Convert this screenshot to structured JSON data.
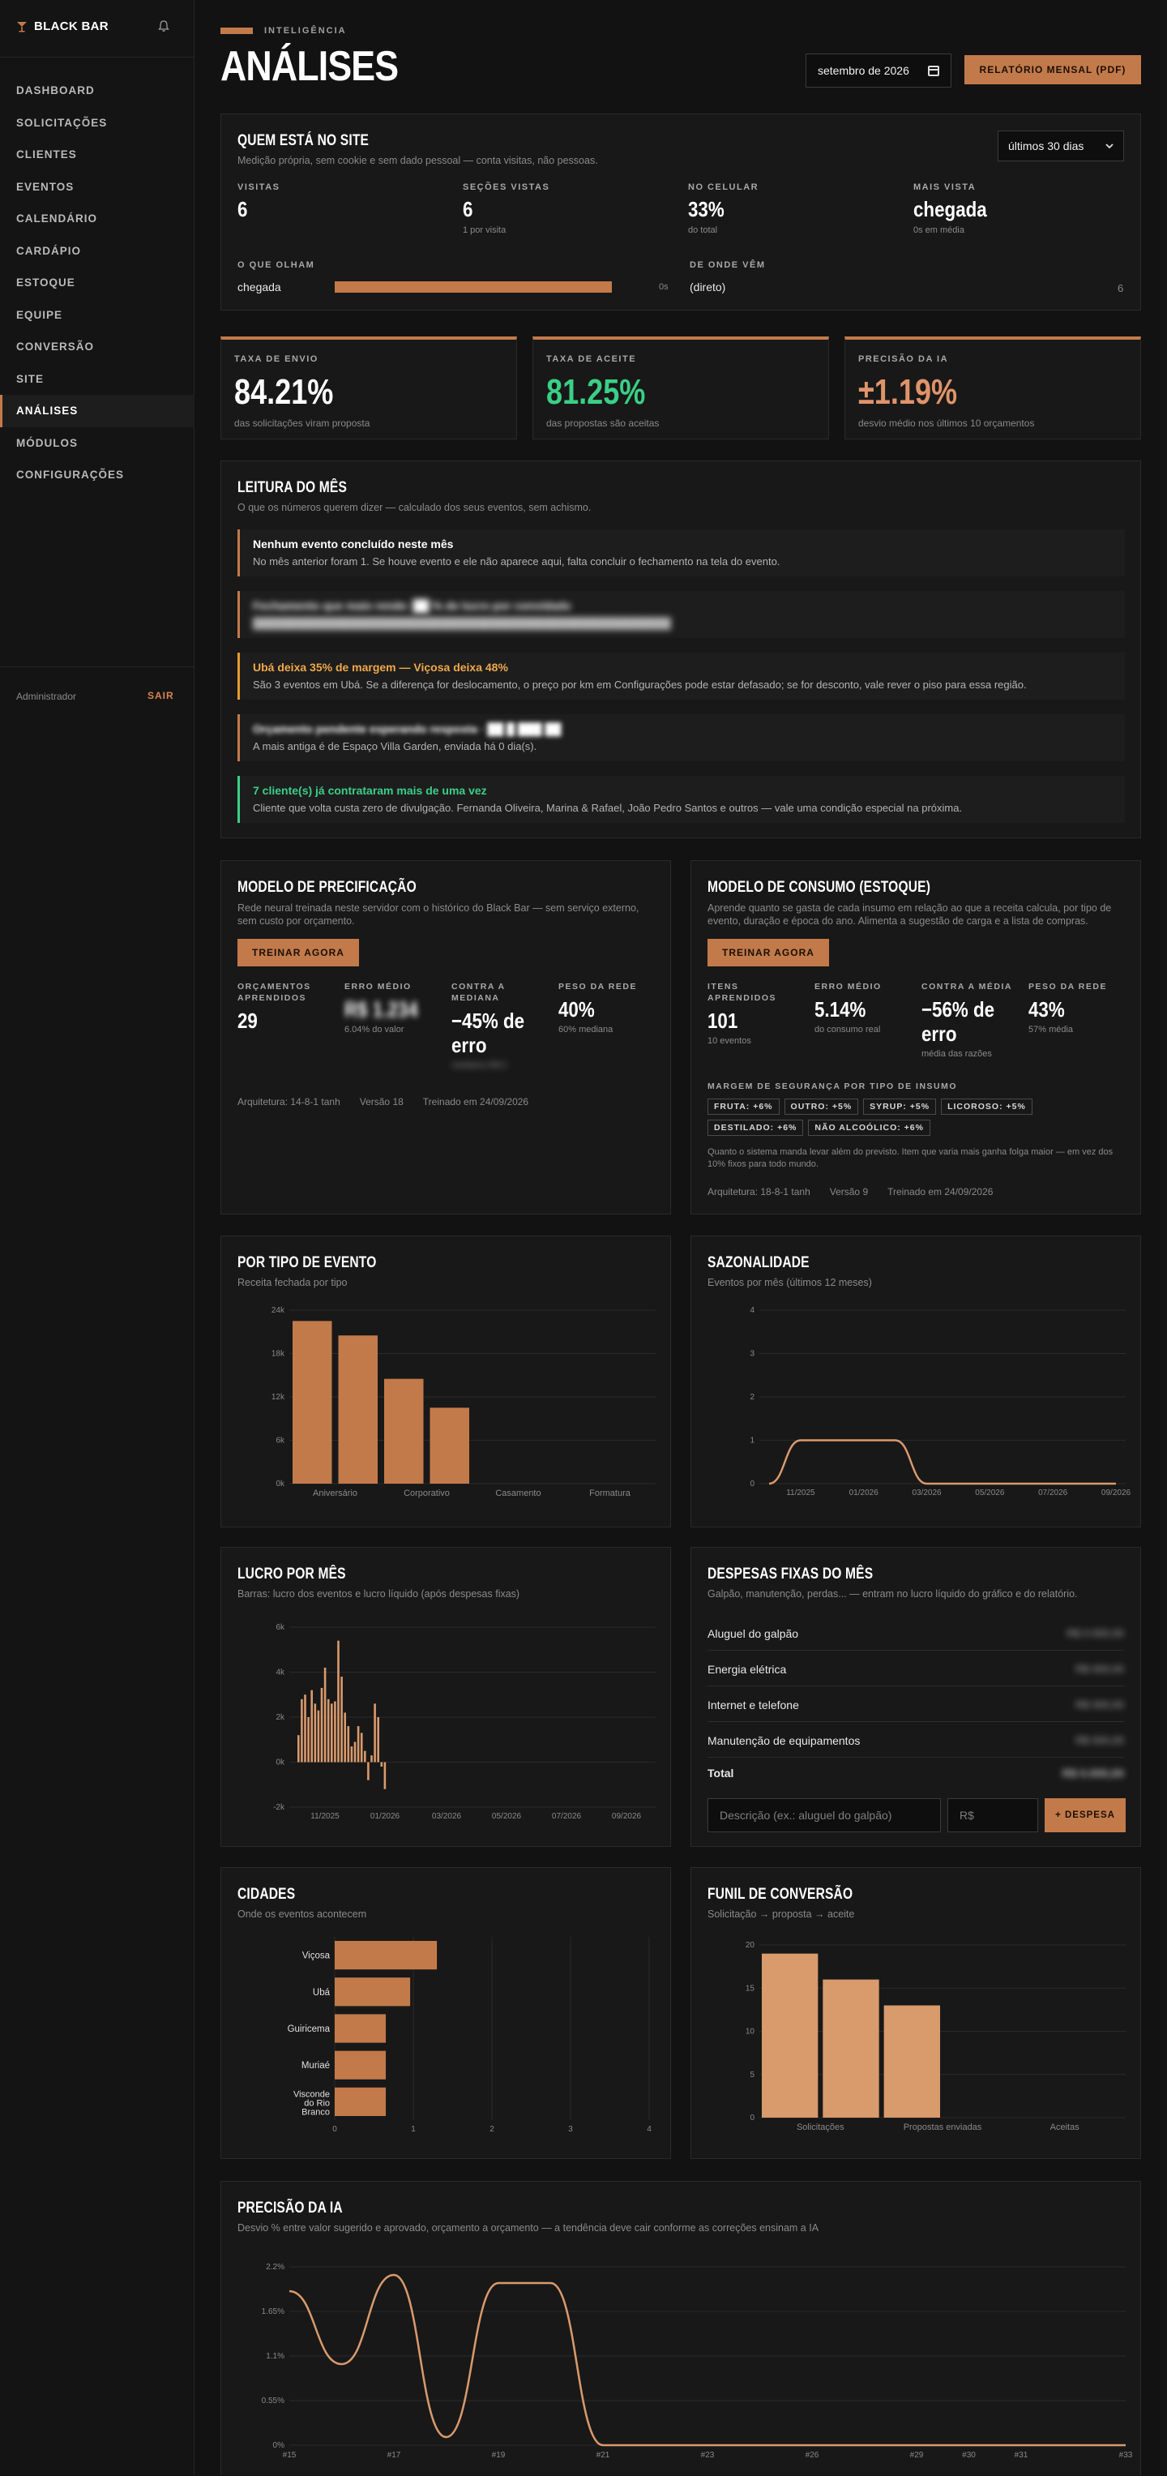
{
  "brand": {
    "name": "BLACK BAR"
  },
  "nav": {
    "items": [
      {
        "label": "DASHBOARD"
      },
      {
        "label": "SOLICITAÇÕES"
      },
      {
        "label": "CLIENTES"
      },
      {
        "label": "EVENTOS"
      },
      {
        "label": "CALENDÁRIO"
      },
      {
        "label": "CARDÁPIO"
      },
      {
        "label": "ESTOQUE"
      },
      {
        "label": "EQUIPE"
      },
      {
        "label": "CONVERSÃO"
      },
      {
        "label": "SITE"
      },
      {
        "label": "ANÁLISES",
        "active": true
      },
      {
        "label": "MÓDULOS"
      },
      {
        "label": "CONFIGURAÇÕES"
      }
    ],
    "user": "Administrador",
    "logout": "SAIR"
  },
  "header": {
    "eyebrow": "INTELIGÊNCIA",
    "title": "ANÁLISES",
    "month": "setembro de 2026",
    "report_button": "RELATÓRIO MENSAL (PDF)"
  },
  "visitors": {
    "title": "QUEM ESTÁ NO SITE",
    "subtitle": "Medição própria, sem cookie e sem dado pessoal — conta visitas, não pessoas.",
    "range": "últimos 30 dias",
    "stats": [
      {
        "label": "VISITAS",
        "value": "6",
        "note": ""
      },
      {
        "label": "SEÇÕES VISTAS",
        "value": "6",
        "note": "1 por visita"
      },
      {
        "label": "NO CELULAR",
        "value": "33%",
        "note": "do total"
      },
      {
        "label": "MAIS VISTA",
        "value": "chegada",
        "note": "0s em média"
      }
    ],
    "looked_label": "O QUE OLHAM",
    "looked_item": "chegada",
    "looked_value": "0s",
    "looked_fraction": 1.0,
    "from_label": "DE ONDE VÊM",
    "from_item": "(direto)",
    "from_value": "6"
  },
  "kpis": [
    {
      "label": "TAXA DE ENVIO",
      "value": "84.21%",
      "note": "das solicitações viram proposta",
      "color": "#ffffff"
    },
    {
      "label": "TAXA DE ACEITE",
      "value": "81.25%",
      "note": "das propostas são aceitas",
      "color": "#3bcf86"
    },
    {
      "label": "PRECISÃO DA IA",
      "value": "±1.19%",
      "note": "desvio médio nos últimos 10 orçamentos",
      "color": "#e0936a"
    }
  ],
  "reading": {
    "title": "LEITURA DO MÊS",
    "subtitle": "O que os números querem dizer — calculado dos seus eventos, sem achismo.",
    "items": [
      {
        "title": "Nenhum evento concluído neste mês",
        "body": "No mês anterior foram 1. Se houve evento e ele não aparece aqui, falta concluir o fechamento na tela do evento."
      },
      {
        "title": "Fechamento que mais rende: ██ % de lucro por convidado",
        "body": "████████████████████████████████████████████████████████"
      },
      {
        "title": "Ubá deixa 35% de margem — Viçosa deixa 48%",
        "body": "São 3 eventos em Ubá. Se a diferença for deslocamento, o preço por km em Configurações pode estar defasado; se for desconto, vale rever o piso para essa região."
      },
      {
        "title": "Orçamento pendente esperando resposta · ██ █ ███ ██",
        "body": "A mais antiga é de Espaço Villa Garden, enviada há 0 dia(s)."
      },
      {
        "title": "7 cliente(s) já contrataram mais de uma vez",
        "body": "Cliente que volta custa zero de divulgação. Fernanda Oliveira, Marina & Rafael, João Pedro Santos e outros — vale uma condição especial na próxima."
      }
    ]
  },
  "pricing_model": {
    "title": "MODELO DE PRECIFICAÇÃO",
    "subtitle": "Rede neural treinada neste servidor com o histórico do Black Bar — sem serviço externo, sem custo por orçamento.",
    "button": "TREINAR AGORA",
    "stats": [
      {
        "label": "ORÇAMENTOS APRENDIDOS",
        "value": "29",
        "note": ""
      },
      {
        "label": "ERRO MÉDIO",
        "value": "R$ 1.234",
        "note": "6.04% do valor"
      },
      {
        "label": "CONTRA A MEDIANA",
        "value": "−45% de erro",
        "note": "mediana R$ 0"
      },
      {
        "label": "PESO DA REDE",
        "value": "40%",
        "note": "60% mediana"
      }
    ],
    "footer": [
      "Arquitetura: 14-8-1 tanh",
      "Versão 18",
      "Treinado em 24/09/2026"
    ]
  },
  "consumption_model": {
    "title": "MODELO DE CONSUMO (ESTOQUE)",
    "subtitle": "Aprende quanto se gasta de cada insumo em relação ao que a receita calcula, por tipo de evento, duração e época do ano. Alimenta a sugestão de carga e a lista de compras.",
    "button": "TREINAR AGORA",
    "stats": [
      {
        "label": "ITENS APRENDIDOS",
        "value": "101",
        "note": "10 eventos"
      },
      {
        "label": "ERRO MÉDIO",
        "value": "5.14%",
        "note": "do consumo real"
      },
      {
        "label": "CONTRA A MÉDIA",
        "value": "−56% de erro",
        "note": "média das razões"
      },
      {
        "label": "PESO DA REDE",
        "value": "43%",
        "note": "57% média"
      }
    ],
    "margin_label": "MARGEM DE SEGURANÇA POR TIPO DE INSUMO",
    "chips": [
      "FRUTA: +6%",
      "OUTRO: +5%",
      "SYRUP: +5%",
      "LICOROSO: +5%",
      "DESTILADO: +6%",
      "NÃO ALCOÓLICO: +6%"
    ],
    "note": "Quanto o sistema manda levar além do previsto. Item que varia mais ganha folga maior — em vez dos 10% fixos para todo mundo.",
    "footer": [
      "Arquitetura: 18-8-1 tanh",
      "Versão 9",
      "Treinado em 24/09/2026"
    ]
  },
  "by_event": {
    "title": "POR TIPO DE EVENTO",
    "subtitle": "Receita fechada por tipo"
  },
  "seasonality": {
    "title": "SAZONALIDADE",
    "subtitle": "Eventos por mês (últimos 12 meses)"
  },
  "profit": {
    "title": "LUCRO POR MÊS",
    "subtitle": "Barras: lucro dos eventos e lucro líquido (após despesas fixas)"
  },
  "expenses": {
    "title": "DESPESAS FIXAS DO MÊS",
    "subtitle": "Galpão, manutenção, perdas... — entram no lucro líquido do gráfico e do relatório.",
    "items": [
      {
        "name": "Aluguel do galpão",
        "value": "R$ 0.000,00"
      },
      {
        "name": "Energia elétrica",
        "value": "R$ 000,00"
      },
      {
        "name": "Internet e telefone",
        "value": "R$ 000,00"
      },
      {
        "name": "Manutenção de equipamentos",
        "value": "R$ 000,00"
      }
    ],
    "total_label": "Total",
    "total_value": "R$ 0.000,00",
    "desc_placeholder": "Descrição (ex.: aluguel do galpão)",
    "value_placeholder": "R$",
    "add_button": "+ DESPESA"
  },
  "cities": {
    "title": "CIDADES",
    "subtitle": "Onde os eventos acontecem"
  },
  "funnel": {
    "title": "FUNIL DE CONVERSÃO",
    "subtitle": "Solicitação → proposta → aceite"
  },
  "ai_precision": {
    "title": "PRECISÃO DA IA",
    "subtitle": "Desvio % entre valor sugerido e aprovado, orçamento a orçamento — a tendência deve cair conforme as correções ensinam a IA"
  },
  "colors": {
    "accent": "#c27a4a",
    "accent_light": "#d99a6c",
    "green": "#3bcf86",
    "orange": "#e59a2f"
  },
  "chart_data": [
    {
      "type": "bar",
      "categories": [
        "Aniversário",
        "",
        "Corporativo",
        "",
        "Casamento",
        "",
        "Formatura",
        ""
      ],
      "tick_labels": [
        "Aniversário",
        "Corporativo",
        "Casamento",
        "Formatura"
      ],
      "values": [
        22500,
        20500,
        14500,
        10500,
        0,
        0,
        0,
        0
      ],
      "ylim": [
        0,
        24000
      ],
      "yticks": [
        "0k",
        "6k",
        "12k",
        "18k",
        "24k"
      ]
    },
    {
      "type": "line",
      "x": [
        "10/2025",
        "11/2025",
        "12/2025",
        "01/2026",
        "02/2026",
        "03/2026",
        "04/2026",
        "05/2026",
        "06/2026",
        "07/2026",
        "08/2026",
        "09/2026"
      ],
      "x_tick_labels": [
        "11/2025",
        "01/2026",
        "03/2026",
        "05/2026",
        "07/2026",
        "09/2026"
      ],
      "values": [
        0,
        1,
        1,
        1,
        1,
        0,
        0,
        0,
        0,
        0,
        0,
        0
      ],
      "ylim": [
        0,
        4
      ],
      "yticks": [
        "0",
        "1",
        "2",
        "3",
        "4"
      ]
    },
    {
      "type": "bar",
      "ylim": [
        -2000,
        6000
      ],
      "yticks": [
        "-2k",
        "0k",
        "2k",
        "4k",
        "6k"
      ],
      "x_tick_labels": [
        "11/2025",
        "01/2026",
        "03/2026",
        "05/2026",
        "07/2026",
        "09/2026"
      ],
      "values": [
        1200,
        2800,
        3000,
        2000,
        3200,
        2600,
        2300,
        3300,
        4200,
        2800,
        2600,
        2700,
        5400,
        3800,
        2200,
        1600,
        700,
        900,
        1600,
        1300,
        500,
        -800,
        300,
        2600,
        2000,
        -200,
        -1200
      ]
    },
    {
      "type": "bar",
      "categories": [
        "Viçosa",
        "Ubá",
        "Guiricema",
        "Muriaé",
        "Visconde do Rio Branco"
      ],
      "values": [
        1.3,
        0.96,
        0.65,
        0.65,
        0.65
      ],
      "xlim": [
        0,
        4
      ],
      "xticks": [
        "0",
        "1",
        "2",
        "3",
        "4"
      ]
    },
    {
      "type": "bar",
      "categories": [
        "Solicitações",
        "",
        "Propostas enviadas",
        "",
        "Aceitas",
        ""
      ],
      "tick_labels": [
        "Solicitações",
        "Propostas enviadas",
        "Aceitas"
      ],
      "values": [
        19,
        16,
        13,
        0,
        0,
        0
      ],
      "ylim": [
        0,
        20
      ],
      "yticks": [
        "0",
        "5",
        "10",
        "15",
        "20"
      ]
    },
    {
      "type": "line",
      "x": [
        "#15",
        "#16",
        "#17",
        "#18",
        "#19",
        "#20",
        "#21",
        "#22",
        "#23",
        "#24",
        "#26",
        "#27",
        "#29",
        "#30",
        "#31",
        "#32",
        "#33"
      ],
      "x_tick_labels": [
        "#15",
        "#17",
        "#19",
        "#21",
        "#23",
        "#26",
        "#29",
        "#30",
        "#31",
        "#33"
      ],
      "values": [
        1.9,
        1.0,
        2.1,
        0.1,
        2.0,
        2.0,
        0.0,
        0.0,
        0.0,
        0.0,
        0.0,
        0.0,
        0.0,
        0.0,
        0.0,
        0.0,
        0.0
      ],
      "ylim": [
        0,
        2.2
      ],
      "yticks": [
        "0%",
        "0.55%",
        "1.1%",
        "1.65%",
        "2.2%"
      ]
    }
  ]
}
